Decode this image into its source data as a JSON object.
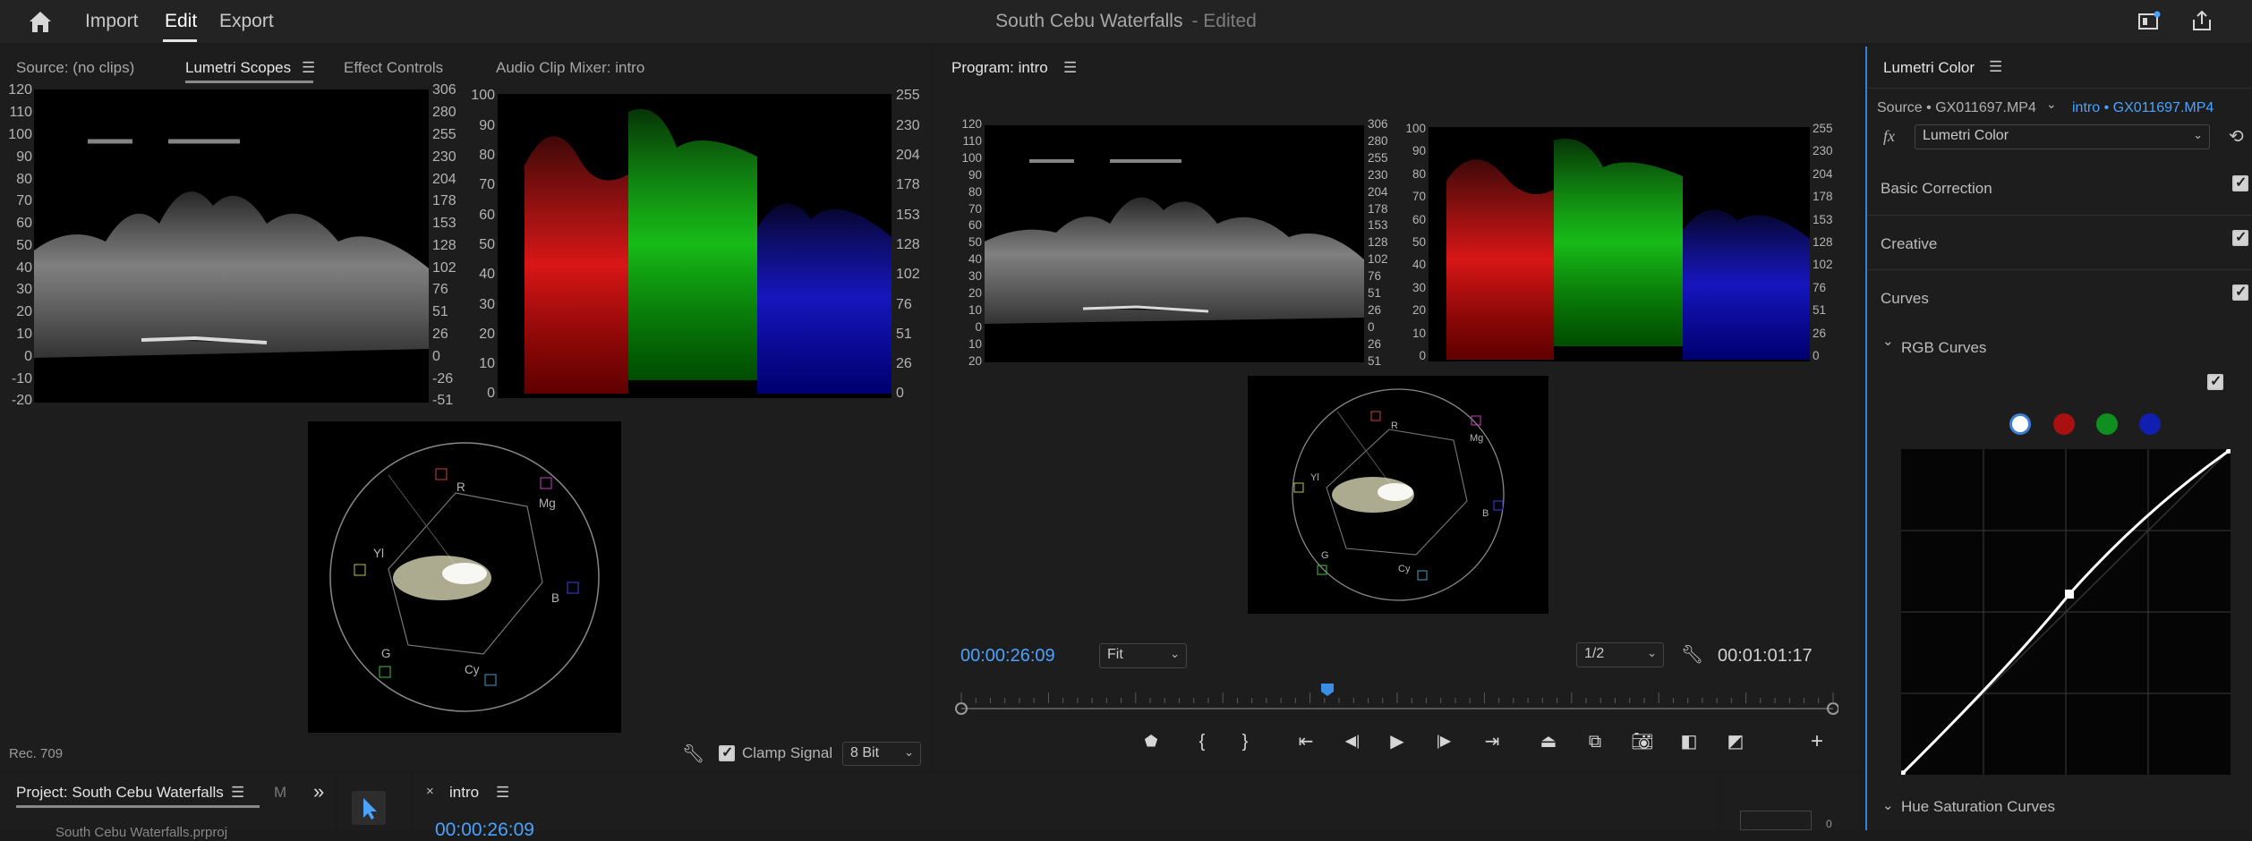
{
  "topbar": {
    "menu": [
      {
        "label": "Import"
      },
      {
        "label": "Edit",
        "active": true
      },
      {
        "label": "Export"
      }
    ],
    "title": "South Cebu Waterfalls",
    "title_status": "- Edited"
  },
  "source_panel": {
    "tabs": [
      {
        "label": "Source: (no clips)"
      },
      {
        "label": "Lumetri Scopes",
        "active": true
      },
      {
        "label": "Effect Controls"
      },
      {
        "label": "Audio Clip Mixer: intro"
      }
    ],
    "waveform_left_labels": [
      "120",
      "110",
      "100",
      "90",
      "80",
      "70",
      "60",
      "50",
      "40",
      "30",
      "20",
      "10",
      "0",
      "-10",
      "-20"
    ],
    "waveform_right_labels": [
      "306",
      "280",
      "255",
      "230",
      "204",
      "178",
      "153",
      "128",
      "102",
      "76",
      "51",
      "26",
      "0",
      "-26",
      "-51"
    ],
    "parade_left_labels": [
      "100",
      "90",
      "80",
      "70",
      "60",
      "50",
      "40",
      "30",
      "20",
      "10",
      "0"
    ],
    "parade_right_labels": [
      "255",
      "230",
      "204",
      "178",
      "153",
      "128",
      "102",
      "76",
      "51",
      "26",
      "0"
    ],
    "vectorscope_labels": {
      "r": "R",
      "mg": "Mg",
      "b": "B",
      "cy": "Cy",
      "g": "G",
      "yl": "Yl"
    },
    "footer": {
      "colorspace": "Rec. 709",
      "clamp_signal": "Clamp Signal",
      "clamp_checked": true,
      "bit_depth": "8 Bit"
    }
  },
  "program_panel": {
    "title": "Program: intro",
    "waveform_left_labels": [
      "120",
      "110",
      "100",
      "90",
      "80",
      "70",
      "60",
      "50",
      "40",
      "30",
      "20",
      "10",
      "0",
      "10",
      "20"
    ],
    "waveform_right_labels": [
      "306",
      "280",
      "255",
      "230",
      "204",
      "178",
      "153",
      "128",
      "102",
      "76",
      "51",
      "26",
      "0",
      "26",
      "51"
    ],
    "parade_left_labels": [
      "100",
      "90",
      "80",
      "70",
      "60",
      "50",
      "40",
      "30",
      "20",
      "10",
      "0"
    ],
    "parade_right_labels": [
      "255",
      "230",
      "204",
      "178",
      "153",
      "128",
      "102",
      "76",
      "51",
      "26",
      "0"
    ],
    "vectorscope_labels": {
      "r": "R",
      "mg": "Mg",
      "b": "B",
      "cy": "Cy",
      "g": "G",
      "yl": "Yl"
    },
    "timecode_current": "00:00:26:09",
    "fit": "Fit",
    "resolution": "1/2",
    "timecode_duration": "00:01:01:17",
    "playhead_fraction": 0.42
  },
  "lumetri_color": {
    "title": "Lumetri Color",
    "source": "Source • GX011697.MP4",
    "target": "intro • GX011697.MP4",
    "fx_label": "fx",
    "effect": "Lumetri Color",
    "sections": [
      {
        "label": "Basic Correction",
        "checked": true
      },
      {
        "label": "Creative",
        "checked": true
      },
      {
        "label": "Curves",
        "checked": true
      }
    ],
    "rgb_curves": "RGB Curves",
    "rgb_checked": true,
    "hue_saturation": "Hue Saturation Curves",
    "channel_colors": [
      "#ffffff",
      "#d01010",
      "#10a010",
      "#1020d0"
    ]
  },
  "bottom": {
    "project_tab": "Project: South Cebu Waterfalls",
    "project_tab2": "M",
    "project_more": "»",
    "sequence_tab": "intro",
    "sequence_timecode": "00:00:26:09",
    "project_item": "South Cebu Waterfalls.prproj",
    "meter_zero": "0"
  },
  "colors": {
    "accent": "#4aa3ff",
    "panel_bg": "#1d1d1d",
    "scope_bg": "#000000"
  }
}
